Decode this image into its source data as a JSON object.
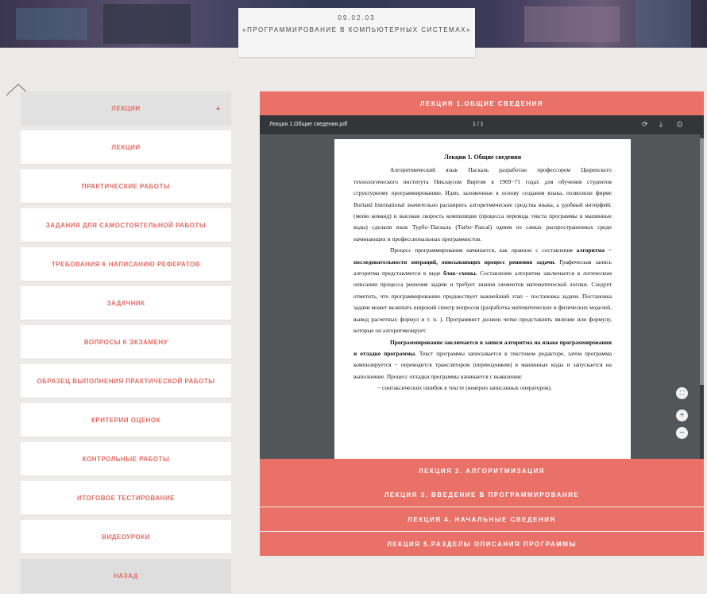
{
  "header": {
    "code": "09.02.03",
    "title": "«ПРОГРАММИРОВАНИЕ В КОМПЬЮТЕРНЫХ СИСТЕМАХ»"
  },
  "sidebar": {
    "head": {
      "label": "ЛЕКЦИИ",
      "caret": "▲"
    },
    "items": [
      "ЛЕКЦИИ",
      "ПРАКТИЧЕСКИЕ РАБОТЫ",
      "ЗАДАНИЯ ДЛЯ САМОСТОЯТЕЛЬНОЙ РАБОТЫ",
      "ТРЕБОВАНИЯ К НАПИСАНИЮ РЕФЕРАТОВ",
      "ЗАДАЧНИК",
      "ВОПРОСЫ К ЭКЗАМЕНУ",
      "ОБРАЗЕЦ ВЫПОЛНЕНИЯ ПРАКТИЧЕСКОЙ РАБОТЫ",
      "КРИТЕРИИ ОЦЕНОК",
      "КОНТРОЛЬНЫЕ РАБОТЫ",
      "ИТОГОВОЕ ТЕСТИРОВАНИЕ",
      "ВИДЕОУРОКИ"
    ],
    "back": "НАЗАД"
  },
  "lectures": {
    "active": "ЛЕКЦИЯ 1.ОБЩИЕ СВЕДЕНИЯ",
    "others": [
      "ЛЕКЦИЯ 2. АЛГОРИТМИЗАЦИЯ",
      "ЛЕКЦИЯ 3. ВВЕДЕНИЕ В ПРОГРАММИРОВАНИЕ",
      "ЛЕКЦИЯ 4. НАЧАЛЬНЫЕ СВЕДЕНИЯ",
      "ЛЕКЦИЯ 5.РАЗДЕЛЫ ОПИСАНИЯ ПРОГРАММЫ"
    ]
  },
  "viewer": {
    "filename": "Лекция 1.Общие сведения.pdf",
    "page_counter": "1 / 1",
    "icons": [
      "rotate-icon",
      "download-icon",
      "print-icon",
      "fit-page-icon",
      "zoom-in-icon",
      "zoom-out-icon"
    ]
  },
  "document": {
    "heading": "Лекция 1.  Общие сведения",
    "p1": "Алгоритмический язык Паскаль разработан профессором Цюрихского технологического института Никлаусом Виртом в 1969−71 годах для обучения студентов структурному программированию. Идеи, заложенные в основу создания языка, позволили фирме Borland International значительно расширить алгоритмические средства языка, а удобный интерфейс (меню команд) и высокая скорость компиляции (процесса перевода текста программы в машинные коды) сделали язык Турбо−Паскаль (Turbo−Pascal) одним из самых распространенных среди начинающих и профессиональных программистов.",
    "p2a": "Процесс программирования начинается, как правило с составления ",
    "p2b": "алгоритма − последовательности операций, описывающих процесс решения задачи.",
    "p2c": " Графическая запись алгоритма представляется в виде ",
    "p2d": "блок−схемы.",
    "p2e": " Составление алгоритма заключается в логическом описании процесса решения задачи и требует знания элементов математической логики. Следует отметить, что программированию предшествует важнейший этап − постановка задачи. Постановка задачи может включать широкий спектр вопросов (разработка математических и физических моделей, вывод расчетных формул и т. п. ). Программист должен четко представлять явление или формулу, которые он алгоритмизирует.",
    "p3a": "Программирование заключается в записи алгоритма на языке программирования и отладке программы.",
    "p3b": " Текст программы записывается в текстовом редакторе, затем программа компилируется − переводится транслятором (переводчиком) в машинные коды и запускается на выполнение. Процесс отладки программы начинается с выявления:",
    "li1": "− синтаксических ошибок в тексте (неверно записанных операторов),"
  },
  "colors": {
    "accent": "#e97168",
    "sidebar_text": "#e26a63",
    "background": "#ecebea",
    "viewer_bg": "#525659",
    "viewer_toolbar": "#323639"
  }
}
